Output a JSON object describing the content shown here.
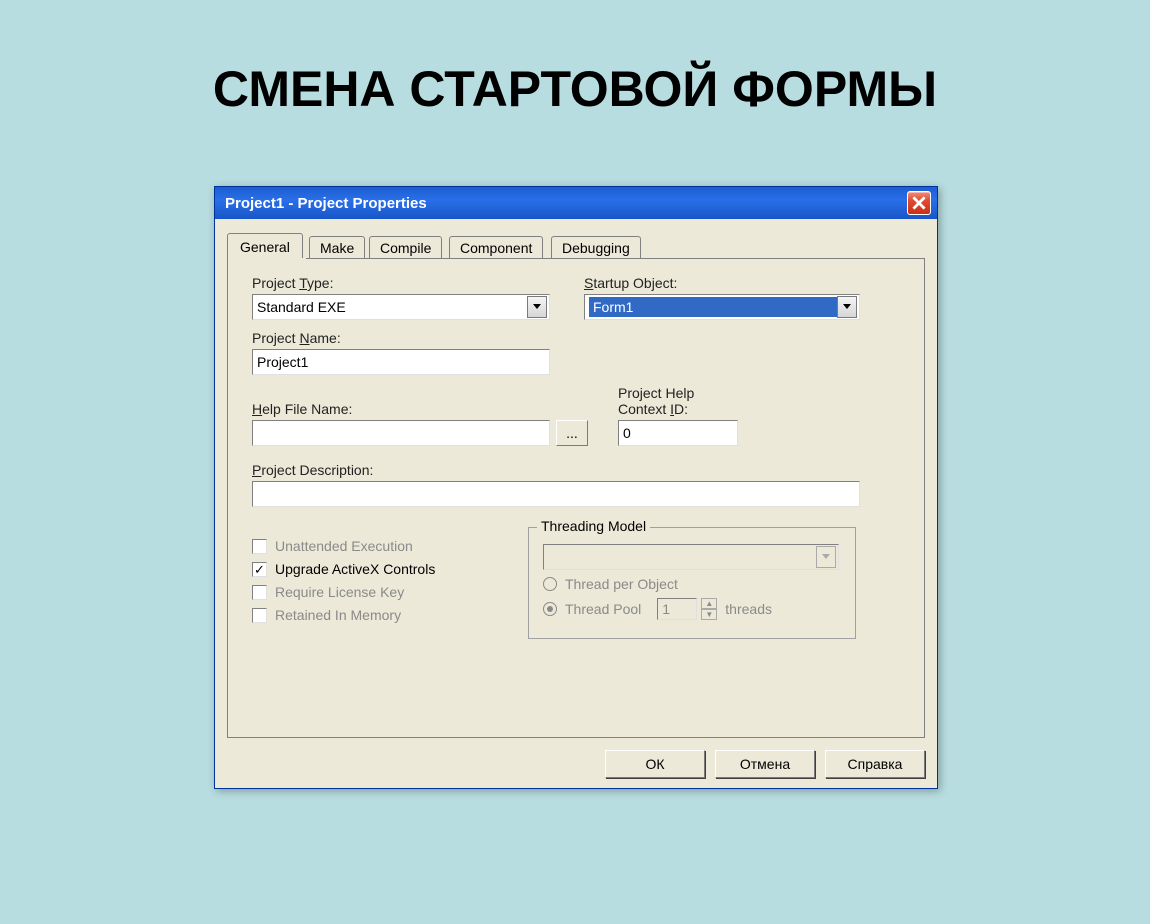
{
  "slide_title": "СМЕНА СТАРТОВОЙ ФОРМЫ",
  "window_title": "Project1 - Project Properties",
  "tabs": [
    "General",
    "Make",
    "Compile",
    "Component",
    "Debugging"
  ],
  "active_tab": "General",
  "labels": {
    "project_type_pre": "Project ",
    "project_type_ul": "T",
    "project_type_post": "ype:",
    "startup_object_ul": "S",
    "startup_object_post": "tartup Object:",
    "project_name_pre": "Project ",
    "project_name_ul": "N",
    "project_name_post": "ame:",
    "helpfile_ul": "H",
    "helpfile_post": "elp File Name:",
    "context_line1": "Project Help",
    "context_line2_pre": "Context ",
    "context_line2_ul": "I",
    "context_line2_post": "D:",
    "description_pre": "",
    "description_ul": "P",
    "description_post": "roject Description:",
    "threading_pre": "Threading ",
    "threading_ul": "M",
    "threading_post": "odel"
  },
  "values": {
    "project_type": "Standard EXE",
    "startup_object": "Form1",
    "project_name": "Project1",
    "help_file": "",
    "context_id": "0",
    "description": "",
    "threading_select": "",
    "thread_pool_count": "1"
  },
  "browse_btn": "...",
  "checkboxes": {
    "unattended": {
      "label_pre": "",
      "ul": "U",
      "post": "nattended Execution",
      "checked": false,
      "enabled": false
    },
    "upgrade": {
      "label_pre": "Up",
      "ul": "g",
      "post": "rade ActiveX Controls",
      "checked": true,
      "enabled": true
    },
    "license": {
      "label_pre": "Require ",
      "ul": "L",
      "post": "icense Key",
      "checked": false,
      "enabled": false
    },
    "retained": {
      "label_pre": "Retained In Memor",
      "ul": "y",
      "post": "",
      "checked": false,
      "enabled": false
    }
  },
  "radios": {
    "per_object": {
      "pre": "Thread per ",
      "ul": "O",
      "post": "bject",
      "selected": false
    },
    "pool": {
      "pre": "Thread P",
      "ul": "o",
      "post": "ol",
      "selected": true
    }
  },
  "threads_label": "threads",
  "buttons": {
    "ok": "ОК",
    "cancel": "Отмена",
    "help": "Справка"
  }
}
